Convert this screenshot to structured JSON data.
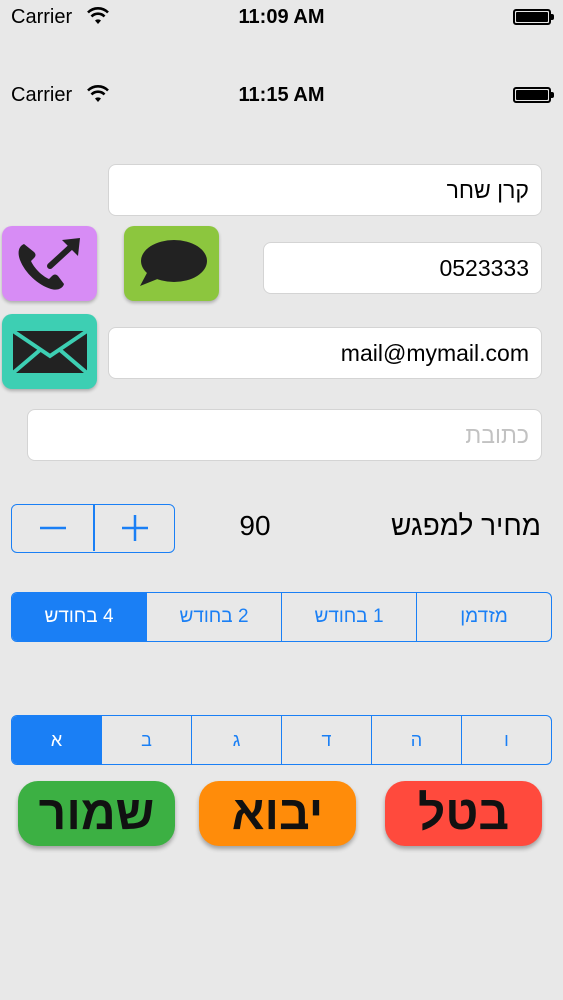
{
  "status_bars": [
    {
      "carrier": "Carrier",
      "time": "11:09 AM"
    },
    {
      "carrier": "Carrier",
      "time": "11:15 AM"
    }
  ],
  "form": {
    "name_value": "קרן שחר",
    "phone_value": "0523333",
    "email_value": "mail@mymail.com",
    "address_placeholder": "כתובת"
  },
  "icons": {
    "call": {
      "name": "phone-call-icon",
      "color": "#d78cf5"
    },
    "sms": {
      "name": "chat-bubble-icon",
      "color": "#8cc63e"
    },
    "mail": {
      "name": "envelope-icon",
      "color": "#3dcfb3"
    }
  },
  "price": {
    "label": "מחיר למפגש",
    "value": "90",
    "minus": "−",
    "plus": "+"
  },
  "frequency": {
    "options": [
      "4 בחודש",
      "2 בחודש",
      "1 בחודש",
      "מזדמן"
    ],
    "selected": "4 בחודש"
  },
  "group": {
    "options": [
      "א",
      "ב",
      "ג",
      "ד",
      "ה",
      "ו"
    ],
    "selected": "א"
  },
  "buttons": {
    "save": {
      "label": "שמור",
      "color": "#3cb043"
    },
    "import": {
      "label": "יבוא",
      "color": "#ff8c0a"
    },
    "cancel": {
      "label": "בטל",
      "color": "#ff4a3d"
    }
  },
  "accent": "#1a7ff5",
  "background": "#e8e8e8"
}
